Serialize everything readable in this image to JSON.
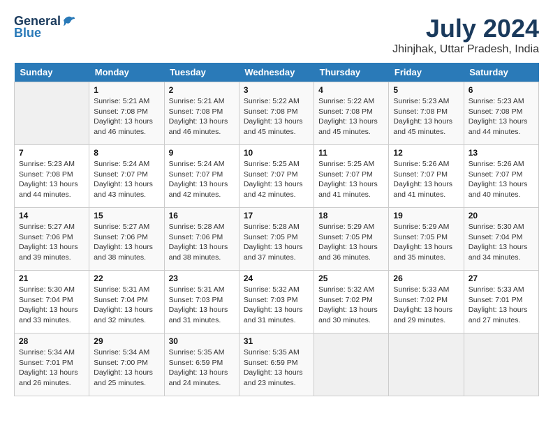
{
  "logo": {
    "general": "General",
    "blue": "Blue"
  },
  "title": {
    "month_year": "July 2024",
    "location": "Jhinjhak, Uttar Pradesh, India"
  },
  "days_of_week": [
    "Sunday",
    "Monday",
    "Tuesday",
    "Wednesday",
    "Thursday",
    "Friday",
    "Saturday"
  ],
  "weeks": [
    [
      {
        "day": "",
        "info": ""
      },
      {
        "day": "1",
        "info": "Sunrise: 5:21 AM\nSunset: 7:08 PM\nDaylight: 13 hours\nand 46 minutes."
      },
      {
        "day": "2",
        "info": "Sunrise: 5:21 AM\nSunset: 7:08 PM\nDaylight: 13 hours\nand 46 minutes."
      },
      {
        "day": "3",
        "info": "Sunrise: 5:22 AM\nSunset: 7:08 PM\nDaylight: 13 hours\nand 45 minutes."
      },
      {
        "day": "4",
        "info": "Sunrise: 5:22 AM\nSunset: 7:08 PM\nDaylight: 13 hours\nand 45 minutes."
      },
      {
        "day": "5",
        "info": "Sunrise: 5:23 AM\nSunset: 7:08 PM\nDaylight: 13 hours\nand 45 minutes."
      },
      {
        "day": "6",
        "info": "Sunrise: 5:23 AM\nSunset: 7:08 PM\nDaylight: 13 hours\nand 44 minutes."
      }
    ],
    [
      {
        "day": "7",
        "info": "Sunrise: 5:23 AM\nSunset: 7:08 PM\nDaylight: 13 hours\nand 44 minutes."
      },
      {
        "day": "8",
        "info": "Sunrise: 5:24 AM\nSunset: 7:07 PM\nDaylight: 13 hours\nand 43 minutes."
      },
      {
        "day": "9",
        "info": "Sunrise: 5:24 AM\nSunset: 7:07 PM\nDaylight: 13 hours\nand 42 minutes."
      },
      {
        "day": "10",
        "info": "Sunrise: 5:25 AM\nSunset: 7:07 PM\nDaylight: 13 hours\nand 42 minutes."
      },
      {
        "day": "11",
        "info": "Sunrise: 5:25 AM\nSunset: 7:07 PM\nDaylight: 13 hours\nand 41 minutes."
      },
      {
        "day": "12",
        "info": "Sunrise: 5:26 AM\nSunset: 7:07 PM\nDaylight: 13 hours\nand 41 minutes."
      },
      {
        "day": "13",
        "info": "Sunrise: 5:26 AM\nSunset: 7:07 PM\nDaylight: 13 hours\nand 40 minutes."
      }
    ],
    [
      {
        "day": "14",
        "info": "Sunrise: 5:27 AM\nSunset: 7:06 PM\nDaylight: 13 hours\nand 39 minutes."
      },
      {
        "day": "15",
        "info": "Sunrise: 5:27 AM\nSunset: 7:06 PM\nDaylight: 13 hours\nand 38 minutes."
      },
      {
        "day": "16",
        "info": "Sunrise: 5:28 AM\nSunset: 7:06 PM\nDaylight: 13 hours\nand 38 minutes."
      },
      {
        "day": "17",
        "info": "Sunrise: 5:28 AM\nSunset: 7:05 PM\nDaylight: 13 hours\nand 37 minutes."
      },
      {
        "day": "18",
        "info": "Sunrise: 5:29 AM\nSunset: 7:05 PM\nDaylight: 13 hours\nand 36 minutes."
      },
      {
        "day": "19",
        "info": "Sunrise: 5:29 AM\nSunset: 7:05 PM\nDaylight: 13 hours\nand 35 minutes."
      },
      {
        "day": "20",
        "info": "Sunrise: 5:30 AM\nSunset: 7:04 PM\nDaylight: 13 hours\nand 34 minutes."
      }
    ],
    [
      {
        "day": "21",
        "info": "Sunrise: 5:30 AM\nSunset: 7:04 PM\nDaylight: 13 hours\nand 33 minutes."
      },
      {
        "day": "22",
        "info": "Sunrise: 5:31 AM\nSunset: 7:04 PM\nDaylight: 13 hours\nand 32 minutes."
      },
      {
        "day": "23",
        "info": "Sunrise: 5:31 AM\nSunset: 7:03 PM\nDaylight: 13 hours\nand 31 minutes."
      },
      {
        "day": "24",
        "info": "Sunrise: 5:32 AM\nSunset: 7:03 PM\nDaylight: 13 hours\nand 31 minutes."
      },
      {
        "day": "25",
        "info": "Sunrise: 5:32 AM\nSunset: 7:02 PM\nDaylight: 13 hours\nand 30 minutes."
      },
      {
        "day": "26",
        "info": "Sunrise: 5:33 AM\nSunset: 7:02 PM\nDaylight: 13 hours\nand 29 minutes."
      },
      {
        "day": "27",
        "info": "Sunrise: 5:33 AM\nSunset: 7:01 PM\nDaylight: 13 hours\nand 27 minutes."
      }
    ],
    [
      {
        "day": "28",
        "info": "Sunrise: 5:34 AM\nSunset: 7:01 PM\nDaylight: 13 hours\nand 26 minutes."
      },
      {
        "day": "29",
        "info": "Sunrise: 5:34 AM\nSunset: 7:00 PM\nDaylight: 13 hours\nand 25 minutes."
      },
      {
        "day": "30",
        "info": "Sunrise: 5:35 AM\nSunset: 6:59 PM\nDaylight: 13 hours\nand 24 minutes."
      },
      {
        "day": "31",
        "info": "Sunrise: 5:35 AM\nSunset: 6:59 PM\nDaylight: 13 hours\nand 23 minutes."
      },
      {
        "day": "",
        "info": ""
      },
      {
        "day": "",
        "info": ""
      },
      {
        "day": "",
        "info": ""
      }
    ]
  ]
}
